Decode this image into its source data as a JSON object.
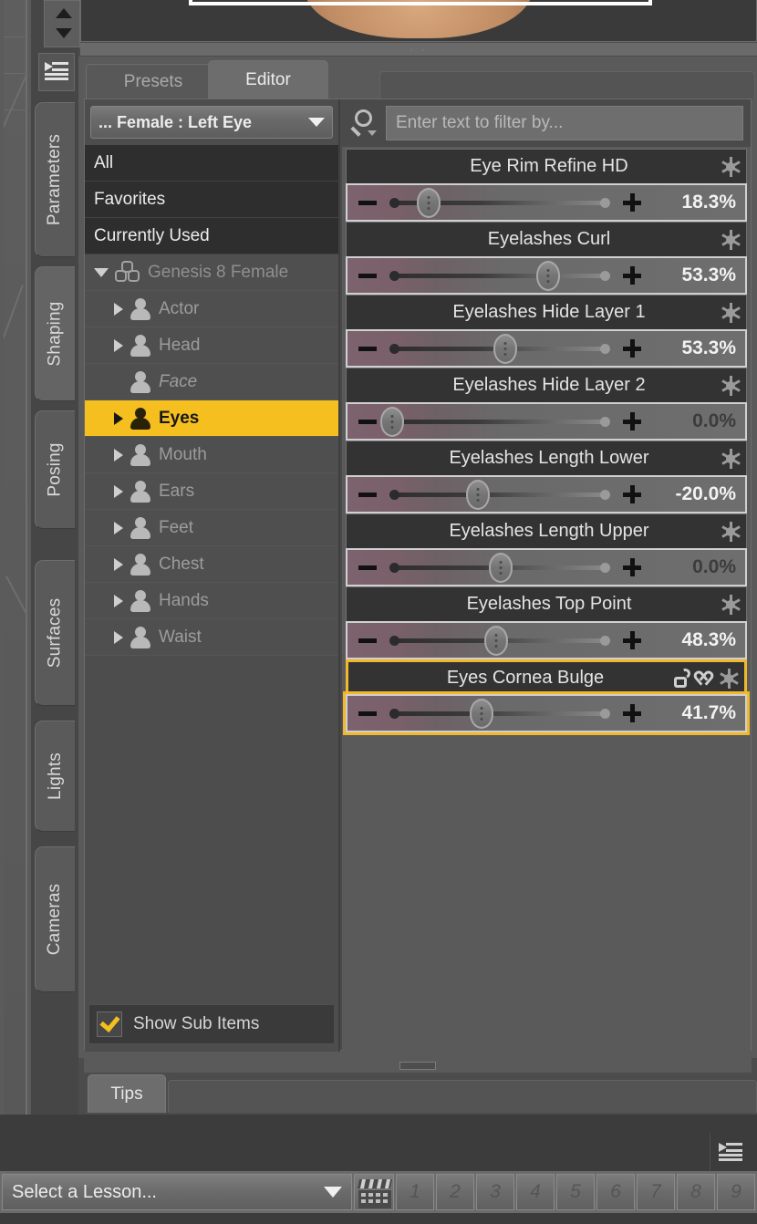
{
  "vertical_tabs": [
    {
      "label": "Parameters",
      "active": false
    },
    {
      "label": "Shaping",
      "active": true
    },
    {
      "label": "Posing",
      "active": false
    },
    {
      "label": "Surfaces",
      "active": false
    },
    {
      "label": "Lights",
      "active": false
    },
    {
      "label": "Cameras",
      "active": false
    }
  ],
  "panel": {
    "tabs": [
      {
        "label": "Presets",
        "active": false
      },
      {
        "label": "Editor",
        "active": true
      }
    ],
    "combo": {
      "value": "... Female : Left Eye",
      "caret": "chevron-down-icon"
    },
    "tree": [
      {
        "label": "All",
        "style": "dark",
        "arrow": "none",
        "icon": "none",
        "depth": 0
      },
      {
        "label": "Favorites",
        "style": "dark",
        "arrow": "none",
        "icon": "none",
        "depth": 0
      },
      {
        "label": "Currently Used",
        "style": "dark",
        "arrow": "none",
        "icon": "none",
        "depth": 0
      },
      {
        "label": "Genesis 8 Female",
        "style": "root",
        "arrow": "down",
        "icon": "genesis",
        "depth": 0
      },
      {
        "label": "Actor",
        "style": "normal",
        "arrow": "right",
        "icon": "person",
        "depth": 1
      },
      {
        "label": "Head",
        "style": "normal",
        "arrow": "right",
        "icon": "person",
        "depth": 1
      },
      {
        "label": "Face",
        "style": "normal italic",
        "arrow": "none",
        "icon": "person",
        "depth": 1
      },
      {
        "label": "Eyes",
        "style": "sel",
        "arrow": "right",
        "icon": "person",
        "depth": 1
      },
      {
        "label": "Mouth",
        "style": "normal",
        "arrow": "right",
        "icon": "person",
        "depth": 1
      },
      {
        "label": "Ears",
        "style": "normal",
        "arrow": "right",
        "icon": "person",
        "depth": 1
      },
      {
        "label": "Feet",
        "style": "normal",
        "arrow": "right",
        "icon": "person",
        "depth": 1
      },
      {
        "label": "Chest",
        "style": "normal",
        "arrow": "right",
        "icon": "person",
        "depth": 1
      },
      {
        "label": "Hands",
        "style": "normal",
        "arrow": "right",
        "icon": "person",
        "depth": 1
      },
      {
        "label": "Waist",
        "style": "normal",
        "arrow": "right",
        "icon": "person",
        "depth": 1
      }
    ],
    "show_sub_items": {
      "label": "Show Sub Items",
      "checked": true
    },
    "search": {
      "placeholder": "Enter text to filter by...",
      "value": "",
      "icon": "search-icon"
    },
    "sliders": [
      {
        "name": "Eye Rim Refine HD",
        "value": "18.3%",
        "fill": 18.3,
        "zero": false,
        "highlight": false,
        "icons": [
          "gear-icon"
        ]
      },
      {
        "name": "Eyelashes Curl",
        "value": "53.3%",
        "fill": 68.0,
        "zero": false,
        "highlight": false,
        "icons": [
          "gear-icon"
        ]
      },
      {
        "name": "Eyelashes Hide Layer 1",
        "value": "53.3%",
        "fill": 53.3,
        "zero": false,
        "highlight": false,
        "icons": [
          "gear-icon"
        ]
      },
      {
        "name": "Eyelashes Hide Layer 2",
        "value": "0.0%",
        "fill": 0.0,
        "zero": true,
        "highlight": false,
        "icons": [
          "gear-icon"
        ]
      },
      {
        "name": "Eyelashes Length Lower",
        "value": "-20.0%",
        "fill": 40.0,
        "zero": false,
        "highlight": false,
        "icons": [
          "gear-icon"
        ]
      },
      {
        "name": "Eyelashes Length Upper",
        "value": "0.0%",
        "fill": 50.0,
        "zero": true,
        "highlight": false,
        "icons": [
          "gear-icon"
        ]
      },
      {
        "name": "Eyelashes Top Point",
        "value": "48.3%",
        "fill": 48.3,
        "zero": false,
        "highlight": false,
        "icons": [
          "gear-icon"
        ]
      },
      {
        "name": "Eyes Cornea Bulge",
        "value": "41.7%",
        "fill": 41.7,
        "zero": false,
        "highlight": true,
        "icons": [
          "lock-open-icon",
          "heart-icon",
          "gear-icon"
        ]
      }
    ]
  },
  "tips": {
    "tab_label": "Tips"
  },
  "bottom": {
    "lesson_select": {
      "value": "Select a Lesson...",
      "caret": "chevron-down-icon"
    },
    "clapper_icon": "film-clapper-icon",
    "number_buttons": [
      "1",
      "2",
      "3",
      "4",
      "5",
      "6",
      "7",
      "8",
      "9"
    ],
    "menu_icon": "panel-menu-icon"
  },
  "colors": {
    "accent_gold": "#f4bf1f",
    "slider_mauve": "#7c626e",
    "panel_bg": "#5a5a5a",
    "tree_bg": "#4d4d4d",
    "row_dark": "#2e2e2e"
  }
}
